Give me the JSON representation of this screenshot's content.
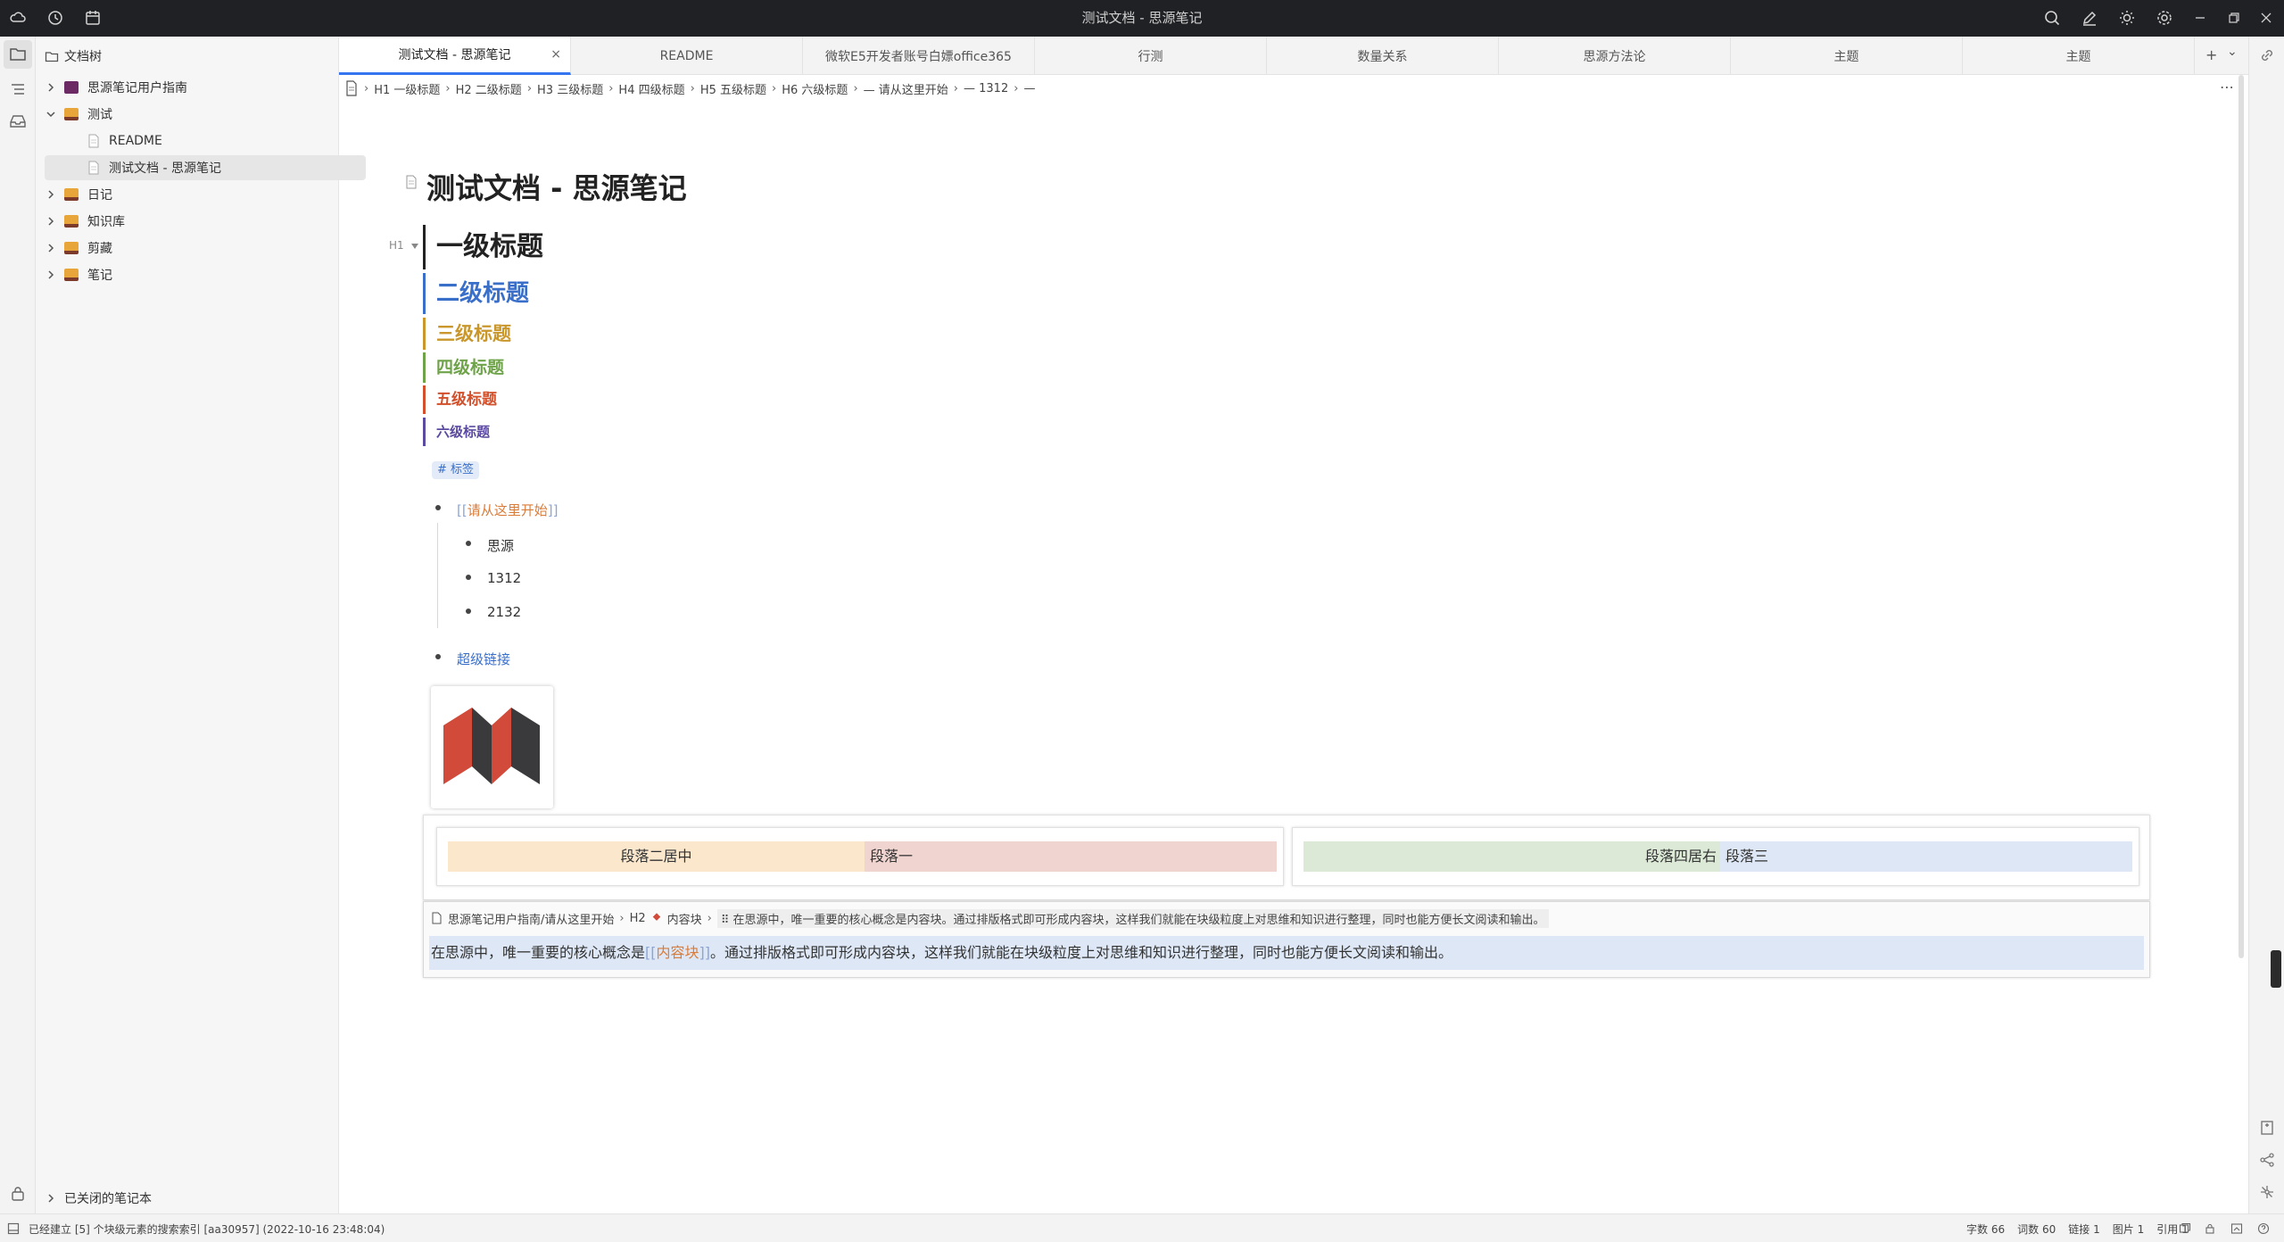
{
  "window": {
    "title": "测试文档 - 思源笔记"
  },
  "sidebar": {
    "header": "文档树",
    "items": [
      {
        "label": "思源笔记用户指南",
        "level": 0,
        "expanded": false,
        "color": "#6b2a63"
      },
      {
        "label": "测试",
        "level": 0,
        "expanded": true,
        "color": "#e8a53a"
      },
      {
        "label": "README",
        "level": 1
      },
      {
        "label": "测试文档 - 思源笔记",
        "level": 1,
        "selected": true
      },
      {
        "label": "日记",
        "level": 0,
        "expanded": false,
        "color": "#e8a53a"
      },
      {
        "label": "知识库",
        "level": 0,
        "expanded": false,
        "color": "#e8a53a"
      },
      {
        "label": "剪藏",
        "level": 0,
        "expanded": false,
        "color": "#e8a53a"
      },
      {
        "label": "笔记",
        "level": 0,
        "expanded": false,
        "color": "#e8a53a"
      }
    ],
    "closed_notebooks": "已关闭的笔记本"
  },
  "tabs": [
    {
      "label": "测试文档 - 思源笔记",
      "active": true,
      "close": "×"
    },
    {
      "label": "README"
    },
    {
      "label": "微软E5开发者账号白嫖office365"
    },
    {
      "label": "行测"
    },
    {
      "label": "数量关系"
    },
    {
      "label": "思源方法论"
    },
    {
      "label": "主题"
    },
    {
      "label": "主题"
    }
  ],
  "tab_controls": {
    "add": "+",
    "more": "⌄"
  },
  "breadcrumb": [
    {
      "label": "一级标题",
      "prefix": "H1"
    },
    {
      "label": "二级标题",
      "prefix": "H2"
    },
    {
      "label": "三级标题",
      "prefix": "H3"
    },
    {
      "label": "四级标题",
      "prefix": "H4"
    },
    {
      "label": "五级标题",
      "prefix": "H5"
    },
    {
      "label": "六级标题",
      "prefix": "H6"
    },
    {
      "label": "请从这里开始",
      "prefix": "—"
    },
    {
      "label": "1312",
      "prefix": "—"
    },
    {
      "label": "",
      "prefix": "—"
    }
  ],
  "breadcrumb_more": "⋯",
  "doc": {
    "title": "测试文档 - 思源笔记",
    "h1_gutter": "H1",
    "headings": [
      {
        "level": 1,
        "text": "一级标题",
        "color": "#222222"
      },
      {
        "level": 2,
        "text": "二级标题",
        "color": "#3a6fc9"
      },
      {
        "level": 3,
        "text": "三级标题",
        "color": "#c9972b"
      },
      {
        "level": 4,
        "text": "四级标题",
        "color": "#6fa34a"
      },
      {
        "level": 5,
        "text": "五级标题",
        "color": "#d2512c"
      },
      {
        "level": 6,
        "text": "六级标题",
        "color": "#5b4aa0"
      }
    ],
    "tag": "# 标签",
    "list": {
      "ref_open": "[[",
      "ref_text": "请从这里开始",
      "ref_close": "]]",
      "children": [
        "思源",
        "1312",
        "2132"
      ],
      "link": "超级链接"
    },
    "columns": {
      "left": [
        {
          "text": "段落二居中",
          "bg": "#fbe7cc"
        },
        {
          "text": "段落一",
          "bg": "#f0d4d0"
        }
      ],
      "right": [
        {
          "text": "段落四居右",
          "bg": "#dbe9d6"
        },
        {
          "text": "段落三",
          "bg": "#dde7f5"
        }
      ]
    },
    "embed": {
      "crumb_path": "思源笔记用户指南/请从这里开始",
      "crumb_heading_prefix": "H2",
      "crumb_heading": "内容块",
      "crumb_block": "在思源中，唯一重要的核心概念是内容块。通过排版格式即可形成内容块，这样我们就能在块级粒度上对思维和知识进行整理，同时也能方便长文阅读和输出。",
      "body_before": "在思源中，唯一重要的核心概念是",
      "ref_open": "[[",
      "ref_text": "内容块",
      "ref_close": "]]",
      "body_after": "。通过排版格式即可形成内容块，这样我们就能在块级粒度上对思维和知识进行整理，同时也能方便长文阅读和输出。"
    }
  },
  "status": {
    "message": "已经建立 [5] 个块级元素的搜索索引 [aa30957] (2022-10-16 23:48:04)",
    "counts": [
      {
        "label": "字数",
        "value": "66"
      },
      {
        "label": "词数",
        "value": "60"
      },
      {
        "label": "链接",
        "value": "1"
      },
      {
        "label": "图片",
        "value": "1"
      },
      {
        "label": "引用",
        "value": "1"
      }
    ]
  },
  "colors": {
    "accent": "#3575f0",
    "ref": "#d97c3a",
    "titlebar": "#202124"
  }
}
